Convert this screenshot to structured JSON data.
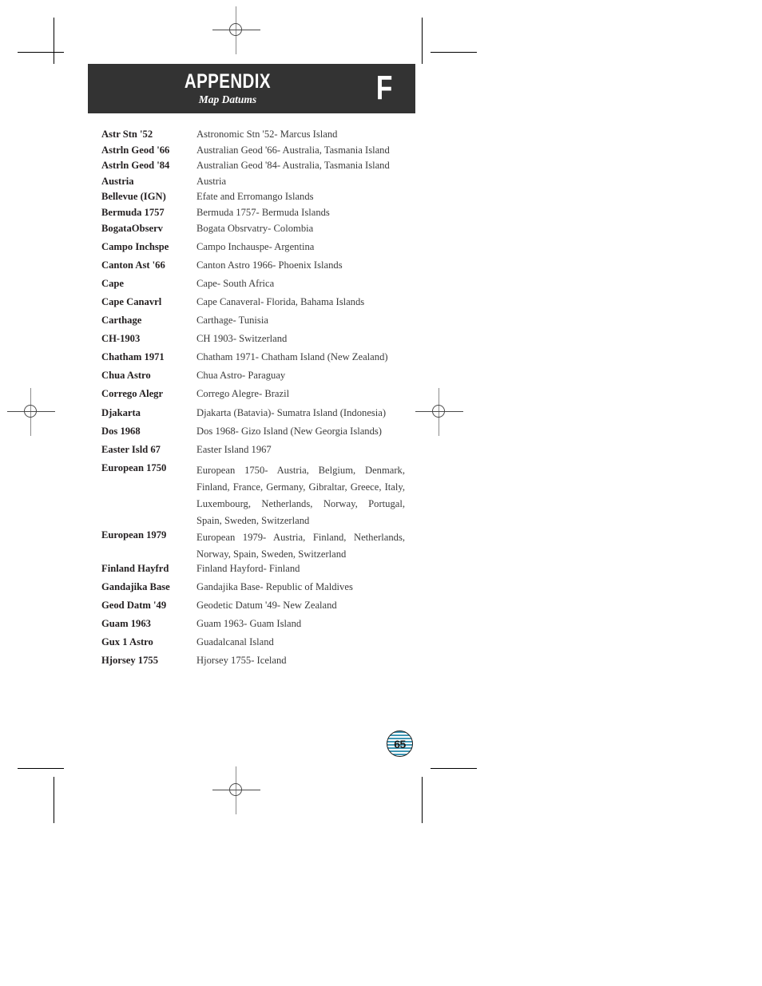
{
  "header": {
    "appendix_label": "APPENDIX",
    "subtitle": "Map Datums",
    "letter": "F",
    "band_color": "#333333"
  },
  "page": {
    "number": "65"
  },
  "datums": [
    {
      "name": "Astr Stn '52",
      "desc": "Astronomic Stn '52- Marcus Island",
      "spacing": "tight"
    },
    {
      "name": "Astrln Geod '66",
      "desc": "Australian Geod '66- Australia, Tasmania Island",
      "spacing": "tight"
    },
    {
      "name": "Astrln Geod '84",
      "desc": "Australian Geod '84- Australia, Tasmania Island",
      "spacing": "tight"
    },
    {
      "name": "Austria",
      "desc": "Austria",
      "spacing": "tight"
    },
    {
      "name": "Bellevue (IGN)",
      "desc": "Efate and Erromango Islands",
      "spacing": "tight"
    },
    {
      "name": "Bermuda 1757",
      "desc": "Bermuda 1757- Bermuda Islands",
      "spacing": "tight"
    },
    {
      "name": "BogataObserv",
      "desc": "Bogata Obsrvatry- Colombia",
      "spacing": "loose"
    },
    {
      "name": "Campo Inchspe",
      "desc": "Campo Inchauspe- Argentina",
      "spacing": "loose"
    },
    {
      "name": "Canton Ast '66",
      "desc": "Canton Astro 1966- Phoenix Islands",
      "spacing": "loose"
    },
    {
      "name": "Cape",
      "desc": "Cape- South Africa",
      "spacing": "loose"
    },
    {
      "name": "Cape Canavrl",
      "desc": "Cape Canaveral- Florida, Bahama Islands",
      "spacing": "loose"
    },
    {
      "name": "Carthage",
      "desc": "Carthage- Tunisia",
      "spacing": "loose"
    },
    {
      "name": "CH-1903",
      "desc": "CH 1903- Switzerland",
      "spacing": "loose"
    },
    {
      "name": "Chatham 1971",
      "desc": "Chatham 1971- Chatham Island (New Zealand)",
      "spacing": "loose"
    },
    {
      "name": "Chua Astro",
      "desc": "Chua Astro- Paraguay",
      "spacing": "loose"
    },
    {
      "name": "Corrego Alegr",
      "desc": "Corrego Alegre- Brazil",
      "spacing": "loose"
    },
    {
      "name": "Djakarta",
      "desc": "Djakarta (Batavia)- Sumatra Island (Indonesia)",
      "spacing": "loose"
    },
    {
      "name": "Dos 1968",
      "desc": "Dos 1968- Gizo Island (New Georgia Islands)",
      "spacing": "loose"
    },
    {
      "name": "Easter Isld 67",
      "desc": "Easter Island 1967",
      "spacing": "loose"
    },
    {
      "name": "European 1750",
      "desc": "European 1750- Austria, Belgium, Denmark, Finland, France, Germany, Gibraltar, Greece, Italy, Luxembourg, Netherlands, Norway, Portugal, Spain, Sweden, Switzerland",
      "spacing": "multiline"
    },
    {
      "name": "European 1979",
      "desc": "European 1979- Austria, Finland, Netherlands, Norway, Spain, Sweden, Switzerland",
      "spacing": "multiline"
    },
    {
      "name": "Finland Hayfrd",
      "desc": "Finland Hayford- Finland",
      "spacing": "loose"
    },
    {
      "name": "Gandajika Base",
      "desc": "Gandajika Base- Republic of Maldives",
      "spacing": "loose"
    },
    {
      "name": "Geod Datm '49",
      "desc": "Geodetic Datum '49- New Zealand",
      "spacing": "loose"
    },
    {
      "name": "Guam 1963",
      "desc": "Guam 1963- Guam Island",
      "spacing": "loose"
    },
    {
      "name": "Gux 1 Astro",
      "desc": "Guadalcanal Island",
      "spacing": "loose"
    },
    {
      "name": "Hjorsey 1755",
      "desc": "Hjorsey 1755- Iceland",
      "spacing": "loose"
    }
  ]
}
